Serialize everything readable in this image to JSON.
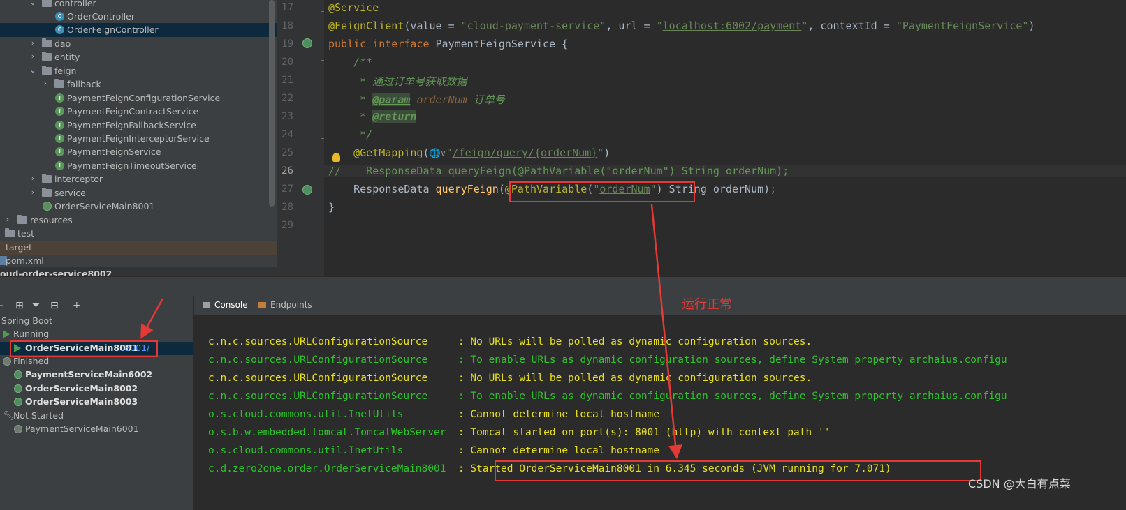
{
  "project_tree": {
    "items": [
      {
        "label": "controller",
        "kind": "folder",
        "expanded": true
      },
      {
        "label": "OrderController",
        "kind": "class"
      },
      {
        "label": "OrderFeignController",
        "kind": "class",
        "selected": true
      },
      {
        "label": "dao",
        "kind": "folder",
        "expanded": false
      },
      {
        "label": "entity",
        "kind": "folder",
        "expanded": false
      },
      {
        "label": "feign",
        "kind": "folder",
        "expanded": true
      },
      {
        "label": "fallback",
        "kind": "folder",
        "expanded": false
      },
      {
        "label": "PaymentFeignConfigurationService",
        "kind": "interface"
      },
      {
        "label": "PaymentFeignContractService",
        "kind": "interface"
      },
      {
        "label": "PaymentFeignFallbackService",
        "kind": "interface"
      },
      {
        "label": "PaymentFeignInterceptorService",
        "kind": "interface"
      },
      {
        "label": "PaymentFeignService",
        "kind": "interface"
      },
      {
        "label": "PaymentFeignTimeoutService",
        "kind": "interface"
      },
      {
        "label": "interceptor",
        "kind": "folder",
        "expanded": false
      },
      {
        "label": "service",
        "kind": "folder",
        "expanded": false
      },
      {
        "label": "OrderServiceMain8001",
        "kind": "spring-class"
      },
      {
        "label": "resources",
        "kind": "folder",
        "expanded": false
      },
      {
        "label": "test",
        "kind": "folder"
      },
      {
        "label": "target",
        "kind": "folder"
      },
      {
        "label": "pom.xml",
        "kind": "xml"
      },
      {
        "label": "oud-order-service8002",
        "kind": "module"
      }
    ]
  },
  "editor": {
    "line_numbers": [
      "17",
      "18",
      "19",
      "20",
      "21",
      "22",
      "23",
      "24",
      "25",
      "26",
      "27",
      "28",
      "29"
    ],
    "line17": {
      "annotation": "@Service"
    },
    "line18": {
      "annotation": "@FeignClient",
      "open": "(value = ",
      "value": "\"cloud-payment-service\"",
      "comma1": ", url = ",
      "url_q1": "\"",
      "url": "localhost:6002/payment",
      "url_q2": "\"",
      "comma2": ", contextId = ",
      "context_id": "\"PaymentFeignService\"",
      "close": ")"
    },
    "line19": {
      "kw1": "public",
      "kw2": "interface",
      "name": "PaymentFeignService",
      "brace": " {"
    },
    "line20": {
      "text": "    /**"
    },
    "line21": {
      "text": "     * 通过订单号获取数据"
    },
    "line22": {
      "star": "     * ",
      "tag": "@param",
      "param": "orderNum",
      "desc": " 订单号"
    },
    "line23": {
      "star": "     * ",
      "tag": "@return"
    },
    "line24": {
      "text": "     */"
    },
    "line25": {
      "annotation": "@GetMapping",
      "open": "(",
      "globe": "🌐∨",
      "q1": "\"",
      "path": "/feign/query/{orderNum}",
      "q2": "\"",
      "close": ")"
    },
    "line26": {
      "text": "//    ResponseData queryFeign(@PathVariable(\"orderNum\") String orderNum);"
    },
    "line27": {
      "type": "    ResponseData ",
      "method": "queryFeign",
      "open": "(",
      "annotation": "@PathVariable",
      "paren": "(",
      "q1": "\"",
      "arg": "orderNum",
      "q2": "\"",
      "close": ")",
      "rest": " String orderNum)",
      "semi": ";"
    },
    "line28": {
      "text": "}"
    }
  },
  "services": {
    "root": "Spring Boot",
    "running_label": "Running",
    "running_item": {
      "name": "OrderServiceMain8001",
      "port": ":8001/"
    },
    "finished_label": "Finished",
    "finished_items": [
      "PaymentServiceMain6002",
      "OrderServiceMain8002",
      "OrderServiceMain8003"
    ],
    "not_started_label": "Not Started",
    "not_started_items": [
      "PaymentServiceMain6001"
    ]
  },
  "console": {
    "tabs": [
      "Console",
      "Endpoints"
    ],
    "lines": [
      {
        "logger": "c.n.c.sources.URLConfigurationSource     ",
        "msg": ": No URLs will be polled as dynamic configuration sources."
      },
      {
        "logger": "c.n.c.sources.URLConfigurationSource     ",
        "msg": ": To enable URLs as dynamic configuration sources, define System property archaius.configu"
      },
      {
        "logger": "c.n.c.sources.URLConfigurationSource     ",
        "msg": ": No URLs will be polled as dynamic configuration sources."
      },
      {
        "logger": "c.n.c.sources.URLConfigurationSource     ",
        "msg": ": To enable URLs as dynamic configuration sources, define System property archaius.configu"
      },
      {
        "logger": "o.s.cloud.commons.util.InetUtils         ",
        "msg": ": Cannot determine local hostname"
      },
      {
        "logger": "o.s.b.w.embedded.tomcat.TomcatWebServer  ",
        "msg": ": Tomcat started on port(s): 8001 (http) with context path ''"
      },
      {
        "logger": "o.s.cloud.commons.util.InetUtils         ",
        "msg": ": Cannot determine local hostname"
      },
      {
        "logger": "c.d.zero2one.order.OrderServiceMain8001  ",
        "msg": ": Started OrderServiceMain8001 in 6.345 seconds (JVM running for 7.071)"
      }
    ]
  },
  "annotation_note": "运行正常",
  "watermark": "CSDN @大白有点菜",
  "colors": {
    "highlight": "#e53935",
    "keyword": "#cc7832",
    "string": "#6a8759",
    "annotation": "#bbb529",
    "log_green": "#2bc52b",
    "log_yellow": "#e8e01e"
  }
}
